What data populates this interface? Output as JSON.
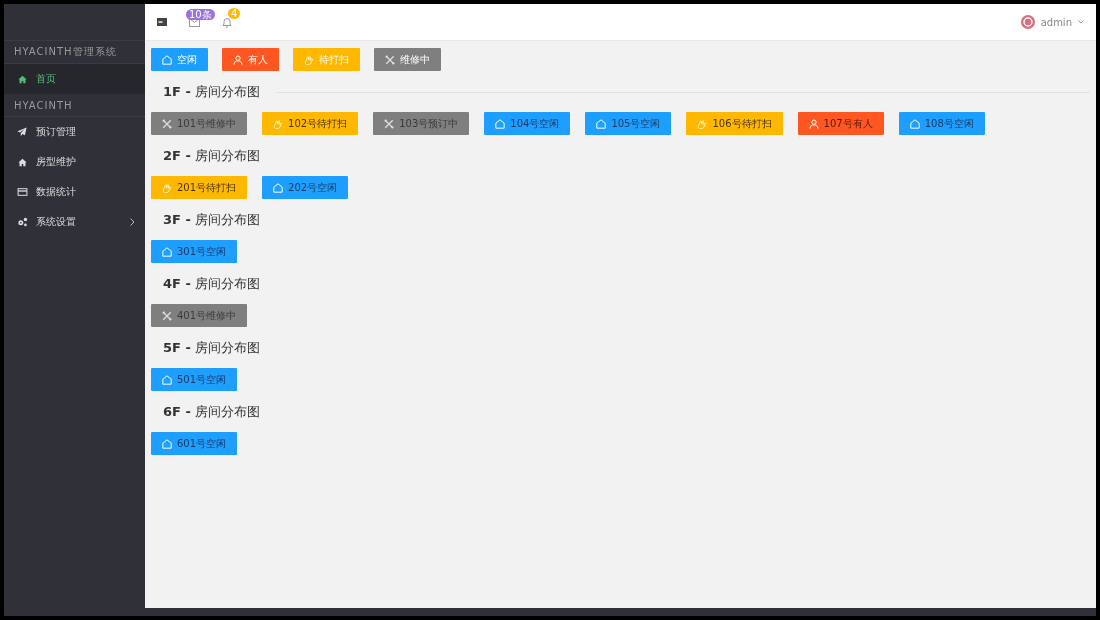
{
  "sidebar": {
    "sections": [
      {
        "title": "HYACINTH管理系统",
        "items": [
          {
            "label": "首页",
            "selected": true,
            "has_children": false
          }
        ]
      },
      {
        "title": "HYACINTH",
        "items": [
          {
            "label": "预订管理",
            "selected": false,
            "has_children": false
          },
          {
            "label": "房型维护",
            "selected": false,
            "has_children": false
          },
          {
            "label": "数据统计",
            "selected": false,
            "has_children": false
          },
          {
            "label": "系统设置",
            "selected": false,
            "has_children": true
          }
        ]
      }
    ]
  },
  "topbar": {
    "mail_badge": "10条",
    "bell_badge": "4",
    "user": "admin"
  },
  "legend": [
    {
      "kind": "free",
      "label": "空闲"
    },
    {
      "kind": "occupied",
      "label": "有人"
    },
    {
      "kind": "cleaning",
      "label": "待打扫"
    },
    {
      "kind": "repair",
      "label": "维修中"
    }
  ],
  "floors": [
    {
      "title": "**1F -** 房间分布图",
      "rooms": [
        {
          "kind": "repair",
          "label": "101号维修中"
        },
        {
          "kind": "cleaning",
          "label": "102号待打扫"
        },
        {
          "kind": "repair",
          "label": "103号预订中"
        },
        {
          "kind": "free",
          "label": "104号空闲"
        },
        {
          "kind": "free",
          "label": "105号空闲"
        },
        {
          "kind": "cleaning",
          "label": "106号待打扫"
        },
        {
          "kind": "occupied",
          "label": "107号有人"
        },
        {
          "kind": "free",
          "label": "108号空闲"
        }
      ]
    },
    {
      "title": "**2F -** 房间分布图",
      "rooms": [
        {
          "kind": "cleaning",
          "label": "201号待打扫"
        },
        {
          "kind": "free",
          "label": "202号空闲"
        }
      ]
    },
    {
      "title": "**3F -** 房间分布图",
      "rooms": [
        {
          "kind": "free",
          "label": "301号空闲"
        }
      ]
    },
    {
      "title": "**4F -** 房间分布图",
      "rooms": [
        {
          "kind": "repair",
          "label": "401号维修中"
        }
      ]
    },
    {
      "title": "**5F -** 房间分布图",
      "rooms": [
        {
          "kind": "free",
          "label": "501号空闲"
        }
      ]
    },
    {
      "title": "**6F -** 房间分布图",
      "rooms": [
        {
          "kind": "free",
          "label": "601号空闲"
        }
      ]
    }
  ]
}
